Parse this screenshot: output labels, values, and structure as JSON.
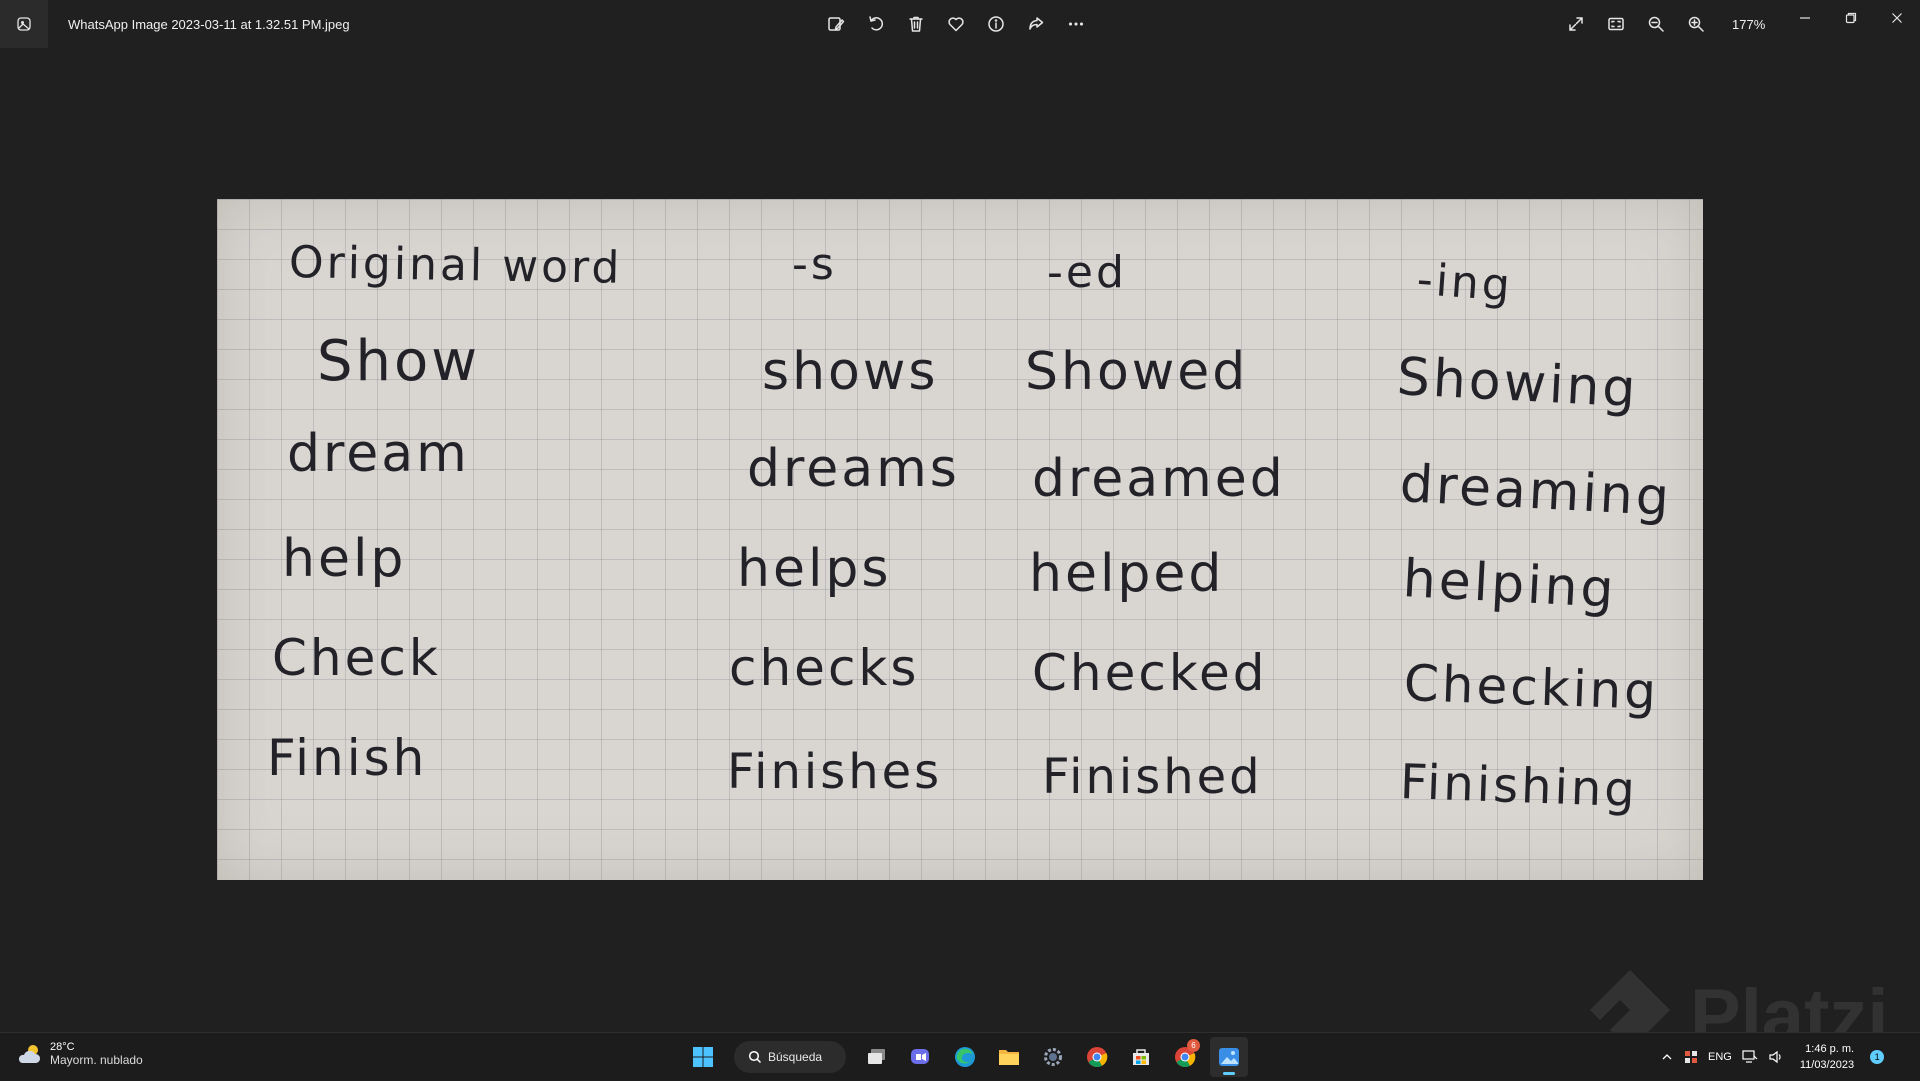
{
  "window": {
    "file_name": "WhatsApp Image 2023-03-11 at 1.32.51 PM.jpeg",
    "zoom_level": "177%"
  },
  "toolbar": {
    "buttons": [
      "edit-icon",
      "rotate-icon",
      "delete-icon",
      "favorite-icon",
      "info-icon",
      "share-icon",
      "more-icon"
    ]
  },
  "view_tools": [
    "fullscreen-icon",
    "fit-icon",
    "zoom-out-icon",
    "zoom-in-icon"
  ],
  "photo": {
    "headers": [
      "Original word",
      "-s",
      "-ed",
      "-ing"
    ],
    "rows": [
      [
        "Show",
        "shows",
        "Showed",
        "Showing"
      ],
      [
        "dream",
        "dreams",
        "dreamed",
        "dreaming"
      ],
      [
        "help",
        "helps",
        "helped",
        "helping"
      ],
      [
        "Check",
        "checks",
        "Checked",
        "Checking"
      ],
      [
        "Finish",
        "Finishes",
        "Finished",
        "Finishing"
      ]
    ]
  },
  "watermark": {
    "text": "Platzi"
  },
  "taskbar": {
    "weather_temp": "28°C",
    "weather_condition": "Mayorm. nublado",
    "search_label": "Búsqueda",
    "chrome_badge": "6",
    "language": "ENG",
    "time": "1:46 p. m.",
    "date": "11/03/2023",
    "notification_count": "1"
  }
}
